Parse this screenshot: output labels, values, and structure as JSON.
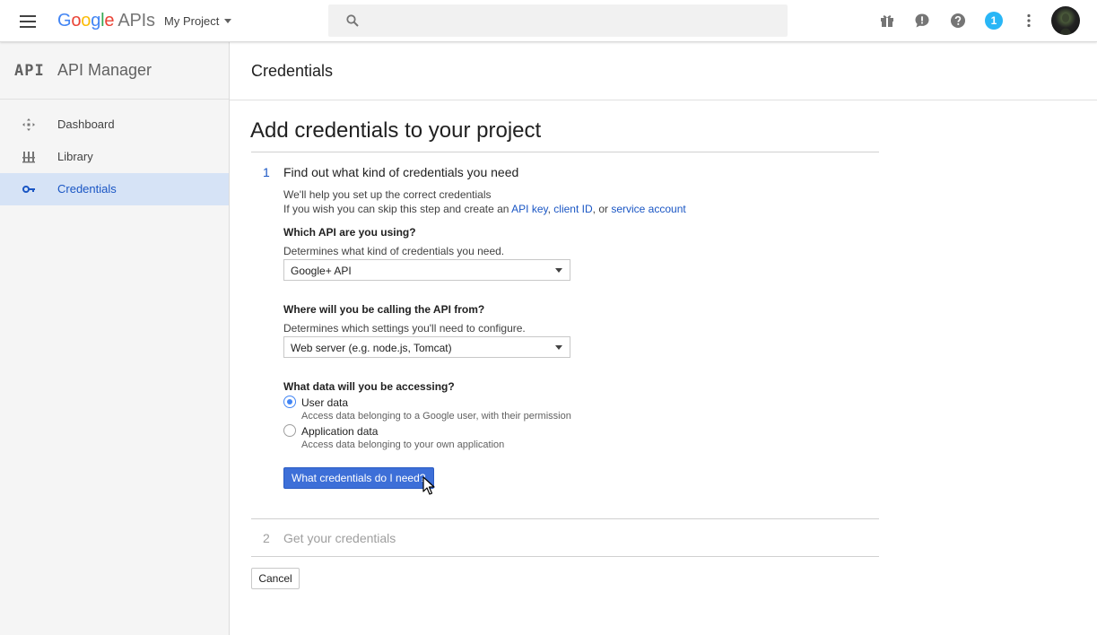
{
  "topbar": {
    "logo_letters": [
      "G",
      "o",
      "o",
      "g",
      "l",
      "e"
    ],
    "logo_apis": "APIs",
    "project": "My Project",
    "notification_count": "1",
    "icons": [
      "menu-icon",
      "search-icon",
      "gift-icon",
      "feedback-icon",
      "help-icon",
      "more-vert-icon"
    ]
  },
  "sidebar": {
    "logo": "API",
    "title": "API Manager",
    "items": [
      {
        "label": "Dashboard",
        "icon": "dashboard-icon",
        "active": false
      },
      {
        "label": "Library",
        "icon": "library-icon",
        "active": false
      },
      {
        "label": "Credentials",
        "icon": "key-icon",
        "active": true
      }
    ]
  },
  "header": {
    "title": "Credentials"
  },
  "main": {
    "heading": "Add credentials to your project",
    "step1": {
      "number": "1",
      "title": "Find out what kind of credentials you need",
      "help1": "We'll help you set up the correct credentials",
      "help2_prefix": "If you wish you can skip this step and create an ",
      "link_api_key": "API key",
      "sep1": ", ",
      "link_client_id": "client ID",
      "sep2": ", or ",
      "link_service_account": "service account",
      "q1": "Which API are you using?",
      "q1_desc": "Determines what kind of credentials you need.",
      "q1_value": "Google+ API",
      "q2": "Where will you be calling the API from?",
      "q2_desc": "Determines which settings you'll need to configure.",
      "q2_value": "Web server (e.g. node.js, Tomcat)",
      "q3": "What data will you be accessing?",
      "options": [
        {
          "label": "User data",
          "desc": "Access data belonging to a Google user, with their permission",
          "selected": true
        },
        {
          "label": "Application data",
          "desc": "Access data belonging to your own application",
          "selected": false
        }
      ],
      "button": "What credentials do I need?"
    },
    "step2": {
      "number": "2",
      "title": "Get your credentials"
    },
    "cancel": "Cancel"
  },
  "colors": {
    "accent": "#4285f4",
    "link": "#1a56c4",
    "button": "#3d6fd8",
    "active_nav": "#d6e3f6",
    "badge": "#29b6f6"
  }
}
